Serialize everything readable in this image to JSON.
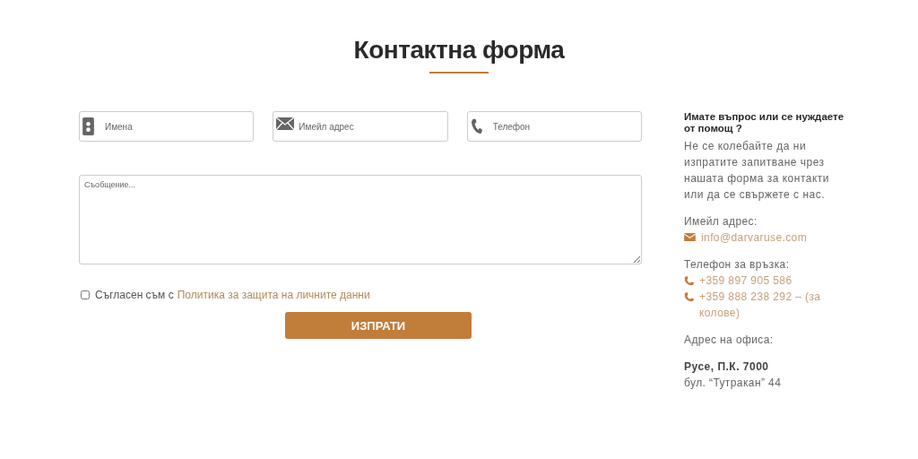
{
  "title": "Контактна форма",
  "fields": [
    {
      "kind": "person",
      "placeholder": "Имена"
    },
    {
      "kind": "mail",
      "placeholder": "Имейл адрес"
    },
    {
      "kind": "phone",
      "placeholder": "Телефон"
    }
  ],
  "message": {
    "placeholder": "Съобщение..."
  },
  "consent": {
    "checked": false,
    "text": "Съгласен съм с",
    "link": "Политика за защита на личните данни"
  },
  "submit": "ИЗПРАТИ",
  "info": {
    "heading": "Имате въпрос или се нуждаете от помощ ?",
    "intro": "Не се колебайте да ни изпратите запитване чрез нашата форма за контакти или да се свържете с нас.",
    "email_label": "Имейл адрес:",
    "email": "info@darvaruse.com",
    "phone_label": "Телефон за връзка:",
    "phones": [
      "+359 897 905 586",
      "+359 888 238 292 – (за колове)"
    ],
    "office_label": "Адрес на офиса:",
    "office_city": "Русе, П.К. 7000",
    "office_street": "бул. “Тутракан” 44"
  }
}
